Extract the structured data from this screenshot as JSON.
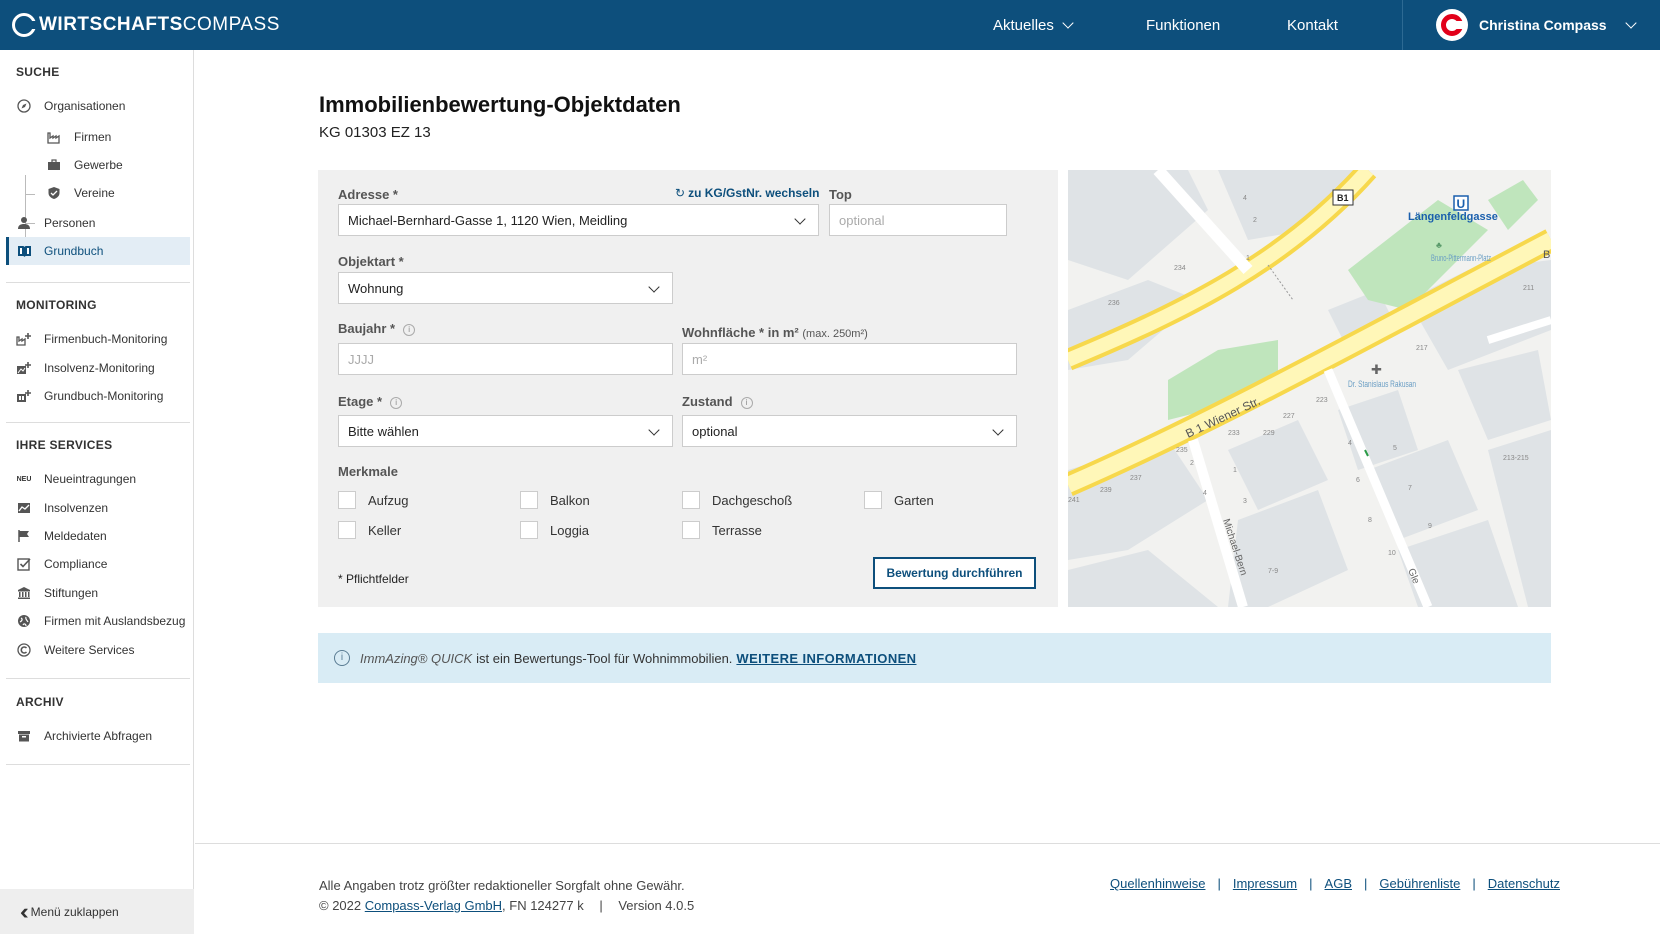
{
  "header": {
    "logo_bold": "WIRTSCHAFTS",
    "logo_light": "COMPASS",
    "nav": [
      {
        "label": "Aktuelles"
      },
      {
        "label": "Funktionen"
      },
      {
        "label": "Kontakt"
      }
    ],
    "user_name": "Christina Compass"
  },
  "sidebar": {
    "sections": {
      "suche": "SUCHE",
      "monitoring": "MONITORING",
      "services": "IHRE SERVICES",
      "archiv": "ARCHIV"
    },
    "suche_items": [
      {
        "label": "Organisationen",
        "icon": "compass-icon"
      },
      {
        "label": "Firmen",
        "icon": "factory-icon"
      },
      {
        "label": "Gewerbe",
        "icon": "briefcase-icon"
      },
      {
        "label": "Vereine",
        "icon": "shield-icon"
      },
      {
        "label": "Personen",
        "icon": "person-icon"
      },
      {
        "label": "Grundbuch",
        "icon": "book-icon"
      }
    ],
    "monitoring_items": [
      {
        "label": "Firmenbuch-Monitoring",
        "icon": "firmenbuch-monitor-icon"
      },
      {
        "label": "Insolvenz-Monitoring",
        "icon": "insolvenz-monitor-icon"
      },
      {
        "label": "Grundbuch-Monitoring",
        "icon": "grundbuch-monitor-icon"
      }
    ],
    "service_items": [
      {
        "label": "Neueintragungen",
        "icon": "neu-icon",
        "glyph": "NEU"
      },
      {
        "label": "Insolvenzen",
        "icon": "insolvenz-icon"
      },
      {
        "label": "Meldedaten",
        "icon": "flag-icon"
      },
      {
        "label": "Compliance",
        "icon": "checkbox-icon"
      },
      {
        "label": "Stiftungen",
        "icon": "building-icon"
      },
      {
        "label": "Firmen mit Auslandsbezug",
        "icon": "globe-icon"
      },
      {
        "label": "Weitere Services",
        "icon": "compass-c-icon"
      }
    ],
    "archiv_items": [
      {
        "label": "Archivierte Abfragen",
        "icon": "archive-icon"
      }
    ],
    "collapse_label": "Menü zuklappen"
  },
  "page": {
    "title": "Immobilienbewertung-Objektdaten",
    "subtitle": "KG 01303 EZ 13"
  },
  "form": {
    "adresse_label": "Adresse *",
    "switch_link": "zu KG/GstNr. wechseln",
    "adresse_value": "Michael-Bernhard-Gasse 1, 1120 Wien, Meidling",
    "top_label": "Top",
    "top_placeholder": "optional",
    "objektart_label": "Objektart *",
    "objektart_value": "Wohnung",
    "baujahr_label": "Baujahr *",
    "baujahr_placeholder": "JJJJ",
    "wohnflaeche_label": "Wohnfläche * in m²",
    "wohnflaeche_hint": "(max. 250m²)",
    "wohnflaeche_placeholder": "m²",
    "etage_label": "Etage *",
    "etage_value": "Bitte wählen",
    "zustand_label": "Zustand",
    "zustand_value": "optional",
    "merkmale_label": "Merkmale",
    "merkmale": [
      "Aufzug",
      "Balkon",
      "Dachgeschoß",
      "Garten",
      "Keller",
      "Loggia",
      "Terrasse"
    ],
    "required_note": "* Pflichtfelder",
    "submit_label": "Bewertung durchführen"
  },
  "map": {
    "station_label": "Längenfeldgasse",
    "ubahn_badge": "U",
    "road_badge": "B1",
    "street_main": "B 1 Wiener Str.",
    "street_side": "Michael-Bern",
    "street_side2": "Gle",
    "edge_label": "B",
    "park_label": "Bruno-Pittermann-Platz",
    "poi_label": "Dr. Stanislaus Rakusan",
    "house_numbers": [
      "4",
      "2",
      "234",
      "236",
      "1",
      "211",
      "217",
      "223",
      "227",
      "229",
      "233",
      "235",
      "237",
      "239",
      "241",
      "2",
      "4",
      "3",
      "1",
      "8",
      "4",
      "6",
      "5",
      "7",
      "9",
      "10",
      "213-215",
      "7-9"
    ]
  },
  "info": {
    "brand": "ImmAzing® QUICK",
    "text": "ist ein Bewertungs-Tool für Wohnimmobilien.",
    "link": "WEITERE INFORMATIONEN"
  },
  "footer": {
    "disclaimer": "Alle Angaben trotz größter redaktioneller Sorgfalt ohne Gewähr.",
    "copyright_prefix": "© 2022",
    "company_link": "Compass-Verlag GmbH",
    "fn": ", FN 124277 k",
    "version": "Version 4.0.5",
    "links": [
      "Quellenhinweise",
      "Impressum",
      "AGB",
      "Gebührenliste",
      "Datenschutz"
    ]
  },
  "colors": {
    "brand_blue": "#0d4f7c",
    "brand_red": "#e2001a",
    "info_bg": "#d9ecf5",
    "panel_bg": "#f0f0f0"
  }
}
